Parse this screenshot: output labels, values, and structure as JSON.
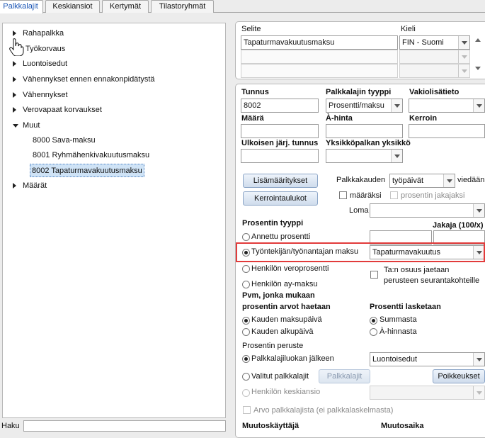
{
  "tabs": [
    "Palkkalajit",
    "Keskiansiot",
    "Kertymät",
    "Tilastoryhmät"
  ],
  "tree": {
    "items": [
      {
        "label": "Rahapalkka"
      },
      {
        "label": "Työkorvaus"
      },
      {
        "label": "Luontoisedut"
      },
      {
        "label": "Vähennykset ennen ennakonpidätystä"
      },
      {
        "label": "Vähennykset"
      },
      {
        "label": "Verovapaat korvaukset"
      },
      {
        "label": "Muut"
      },
      {
        "label": "8000 Sava-maksu"
      },
      {
        "label": "8001 Ryhmähenkivakuutusmaksu"
      },
      {
        "label": "8002 Tapaturmavakuutusmaksu"
      },
      {
        "label": "Määrät"
      }
    ],
    "selected": "8002 Tapaturmavakuutusmaksu",
    "search_label": "Haku"
  },
  "desc_table": {
    "col_selite": "Selite",
    "col_kieli": "Kieli",
    "row1_selite": "Tapaturmavakuutusmaksu",
    "row1_kieli": "FIN - Suomi"
  },
  "form": {
    "tunnus_label": "Tunnus",
    "tunnus_value": "8002",
    "tyyppi_label": "Palkkalajin tyyppi",
    "tyyppi_value": "Prosentti/maksu",
    "vakio_label": "Vakiolisätieto",
    "maara_label": "Määrä",
    "ahinta_label": "À-hinta",
    "kerroin_label": "Kerroin",
    "ulk_label": "Ulkoisen järj. tunnus",
    "yks_label": "Yksikköpalkan yksikkö",
    "lisamaaritykset": "Lisämääritykset",
    "kerrointaulukot": "Kerrointaulukot",
    "palkkakauden_label": "Palkkakauden",
    "palkkakauden_value": "työpäivät",
    "viedaan_label": "viedään",
    "maaraksi": "määräksi",
    "prosentin_jakajaksi": "prosentin jakajaksi",
    "loma_label": "Loma",
    "prosentin_tyyppi": "Prosentin tyyppi",
    "jakaja_label": "Jakaja (100/x)",
    "opt_annettu": "Annettu prosentti",
    "opt_tyontekija": "Työntekijän/työnantajan maksu",
    "tyontekija_value": "Tapaturmavakuutus",
    "opt_veroprosentti": "Henkilön veroprosentti",
    "opt_aymaksu": "Henkilön ay-maksu",
    "tan_osuus": "Ta:n osuus jaetaan",
    "perusteen": "perusteen seurantakohteille",
    "pvm_title1": "Pvm, jonka mukaan",
    "pvm_title2": "prosentin arvot haetaan",
    "opt_maksupaiva": "Kauden maksupäivä",
    "opt_alkupaiva": "Kauden alkupäivä",
    "laskentaan_title": "Prosentti lasketaan",
    "opt_summasta": "Summasta",
    "opt_ahinnasta": "À-hinnasta",
    "peruste_title": "Prosentin peruste",
    "opt_luokan": "Palkkalajiluokan jälkeen",
    "luokka_value": "Luontoisedut",
    "opt_valitut": "Valitut palkkalajit",
    "palkkalajit_btn": "Palkkalajit",
    "poikkeukset_btn": "Poikkeukset",
    "opt_keskiansio": "Henkilön keskiansio",
    "arvo_check": "Arvo palkkalajista (ei palkkalaskelmasta)",
    "muutoskayttaja": "Muutoskäyttäjä",
    "muutosaika": "Muutosaika"
  },
  "colors": {
    "highlight": "#e23b3b",
    "selected_bg": "#cfe3f6",
    "tab_active": "#1a55b5"
  }
}
